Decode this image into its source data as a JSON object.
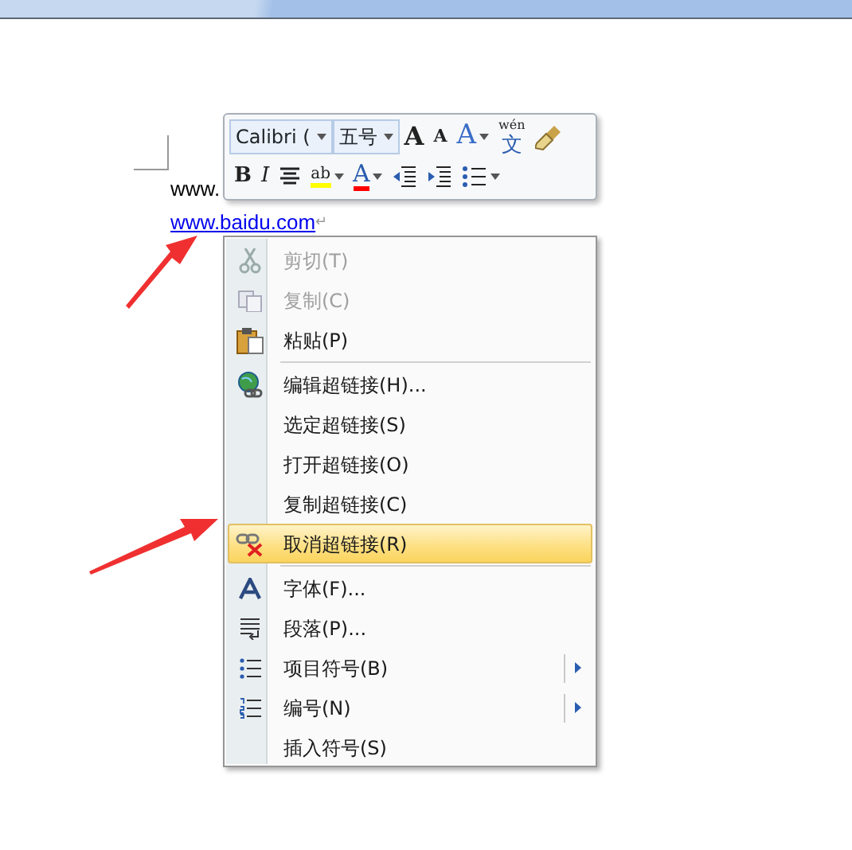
{
  "document": {
    "lines": [
      {
        "text": "www.",
        "link": false
      },
      {
        "text": "www.baidu.com",
        "link": true,
        "mark": "↵"
      }
    ]
  },
  "mini_toolbar": {
    "font_field": "Calibri (",
    "size_field": "五号",
    "row1": [
      {
        "kind": "grow",
        "label": "A"
      },
      {
        "kind": "shrink",
        "label": "A"
      },
      {
        "kind": "effects",
        "label": "A"
      },
      {
        "kind": "phonetic",
        "label": "文",
        "small": "wén"
      },
      {
        "kind": "painter"
      }
    ],
    "row2": [
      {
        "kind": "bold",
        "label": "B"
      },
      {
        "kind": "italic",
        "label": "I"
      },
      {
        "kind": "center"
      },
      {
        "kind": "highlight",
        "label": "ab",
        "color": "#ffff00"
      },
      {
        "kind": "fontcolor",
        "label": "A",
        "color": "#ff0000"
      },
      {
        "kind": "outdent"
      },
      {
        "kind": "indent"
      },
      {
        "kind": "bullets"
      }
    ]
  },
  "context_menu": {
    "items": [
      {
        "label": "剪切(T)",
        "disabled": true,
        "selected": false,
        "submenu": false,
        "separator_before": false
      },
      {
        "label": "复制(C)",
        "disabled": true,
        "selected": false,
        "submenu": false,
        "separator_before": false
      },
      {
        "label": "粘贴(P)",
        "disabled": false,
        "selected": false,
        "submenu": false,
        "separator_before": false
      },
      {
        "label": "编辑超链接(H)...",
        "disabled": false,
        "selected": false,
        "submenu": false,
        "separator_before": true
      },
      {
        "label": "选定超链接(S)",
        "disabled": false,
        "selected": false,
        "submenu": false,
        "separator_before": false
      },
      {
        "label": "打开超链接(O)",
        "disabled": false,
        "selected": false,
        "submenu": false,
        "separator_before": false
      },
      {
        "label": "复制超链接(C)",
        "disabled": false,
        "selected": false,
        "submenu": false,
        "separator_before": false
      },
      {
        "label": "取消超链接(R)",
        "disabled": false,
        "selected": true,
        "submenu": false,
        "separator_before": false
      },
      {
        "label": "字体(F)...",
        "disabled": false,
        "selected": false,
        "submenu": false,
        "separator_before": true
      },
      {
        "label": "段落(P)...",
        "disabled": false,
        "selected": false,
        "submenu": false,
        "separator_before": false
      },
      {
        "label": "项目符号(B)",
        "disabled": false,
        "selected": false,
        "submenu": true,
        "separator_before": false
      },
      {
        "label": "编号(N)",
        "disabled": false,
        "selected": false,
        "submenu": true,
        "separator_before": false
      },
      {
        "label": "插入符号(S)",
        "disabled": false,
        "selected": false,
        "submenu": false,
        "separator_before": false
      }
    ]
  }
}
